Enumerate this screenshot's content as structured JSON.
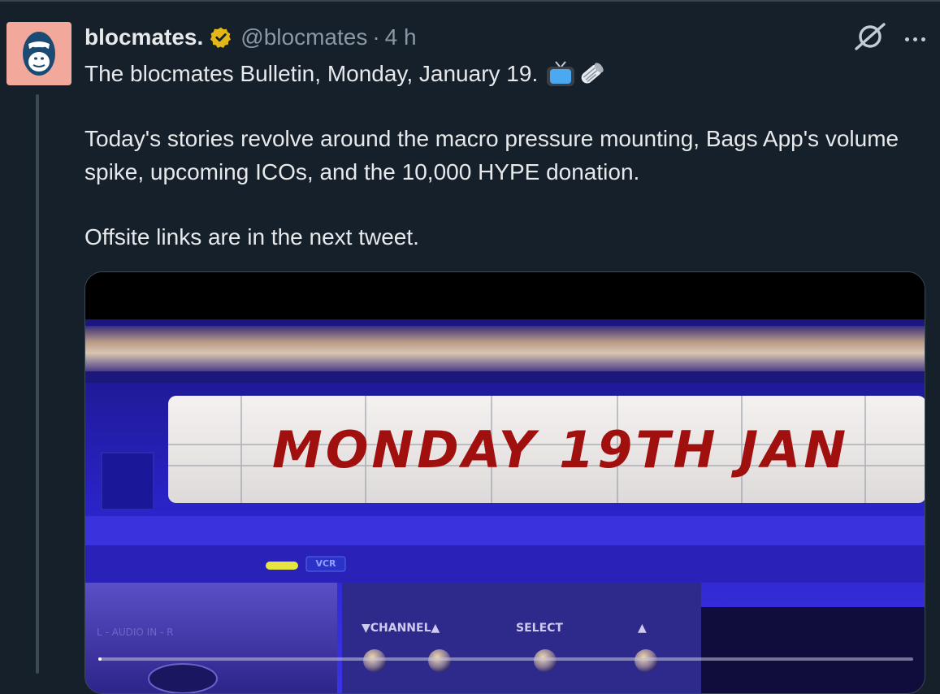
{
  "tweet": {
    "display_name": "blocmates.",
    "handle": "@blocmates",
    "separator": "·",
    "time": "4 h",
    "avatar_icon": "gorilla-logo-icon",
    "verified_icon": "gold-verified-badge-icon",
    "line1": "The blocmates Bulletin, Monday, January 19.",
    "line1_emoji": [
      "television-emoji-icon",
      "rolled-newspaper-emoji-icon"
    ],
    "para2": "Today's stories revolve around the macro pressure mounting, Bags App's volume spike, upcoming ICOs, and the 10,000 HYPE donation.",
    "para3": "Offsite links are in the next tweet."
  },
  "actions": {
    "grok_icon": "grok-icon",
    "more_icon": "more-options-icon"
  },
  "media": {
    "display_date": "MONDAY 19TH JAN",
    "vcr_badge": "VCR",
    "channel_label": "▼CHANNEL▲",
    "select_label": "SELECT",
    "up_label": "▲",
    "audio_label": "L - AUDIO IN - R",
    "video_progress": 0.002
  },
  "colors": {
    "background": "#15202b",
    "text_primary": "#e7e9ea",
    "text_secondary": "#8b98a5",
    "avatar_bg": "#f2a89b",
    "verified_gold": "#e2b719",
    "date_red": "#a0100e"
  }
}
